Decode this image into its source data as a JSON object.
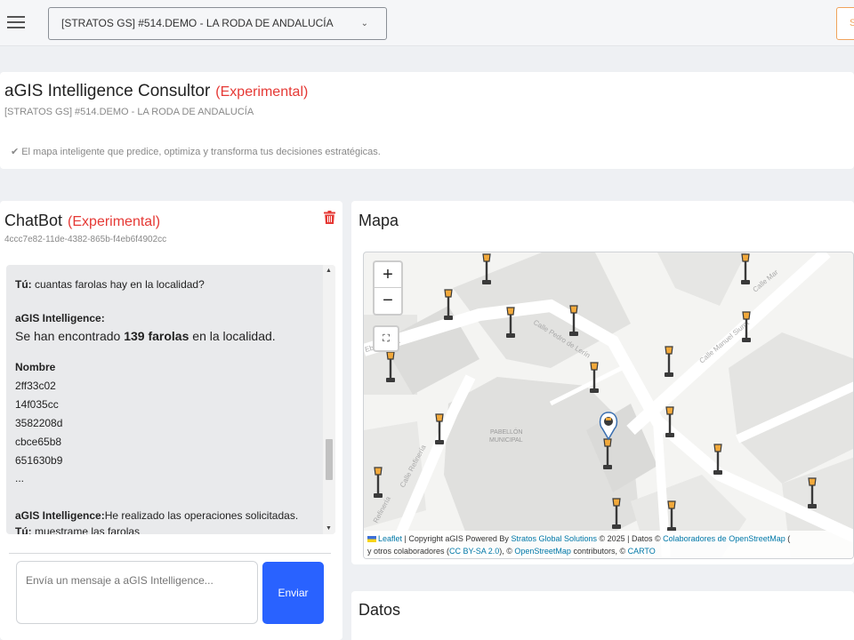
{
  "topbar": {
    "project_select": "[STRATOS GS] #514.DEMO - LA RODA DE ANDALUCÍA",
    "caret": "⌄",
    "right_button": "S"
  },
  "header": {
    "title": "aGIS Intelligence Consultor",
    "experimental": "(Experimental)",
    "subtitle": "[STRATOS GS] #514.DEMO - LA RODA DE ANDALUCÍA",
    "tagline": "El mapa inteligente que predice, optimiza y transforma tus decisiones estratégicas."
  },
  "chatbot": {
    "title": "ChatBot",
    "experimental": "(Experimental)",
    "session_id": "4ccc7e82-11de-4382-865b-f4eb6f4902cc",
    "messages": {
      "user1_label": "Tú:",
      "user1_text": " cuantas farolas hay en la localidad?",
      "bot_label": "aGIS Intelligence:",
      "bot_pre": "Se han encontrado ",
      "bot_bold": "139 farolas",
      "bot_post": " en la localidad.",
      "table_header": "Nombre",
      "rows": [
        "2ff33c02",
        "14f035cc",
        "3582208d",
        "cbce65b8",
        "651630b9",
        "..."
      ],
      "bot2_label": "aGIS Intelligence:",
      "bot2_text": "He realizado las operaciones solicitadas.",
      "user2_label": "Tú:",
      "user2_text": " muestrame las farolas"
    },
    "input_placeholder": "Envía un mensaje a aGIS Intelligence...",
    "send_label": "Enviar"
  },
  "map": {
    "title": "Mapa",
    "zoom_in": "+",
    "zoom_out": "−",
    "fullscreen": "⛶",
    "street_labels": [
      "Calle Pedro de Lerín",
      "Calle Manuel Siurot",
      "Calle Refinería",
      "Refinería",
      "Calle Mar",
      "Ebanistería"
    ],
    "building_label_1": "PABELLÓN",
    "building_label_2": "MUNICIPAL",
    "attribution": {
      "leaflet": "Leaflet",
      "part1": " | Copyright aGIS Powered By ",
      "stratos": "Stratos Global Solutions",
      "part2": " © 2025 | Datos © ",
      "osm_collab": "Colaboradores de OpenStreetMap",
      "part3": " (",
      "line2_pre": "y otros colaboradores (",
      "ccbysa": "CC BY-SA 2.0",
      "line2_mid": "), © ",
      "osm": "OpenStreetMap",
      "line2_post": " contributors, © ",
      "carto": "CARTO"
    }
  },
  "datos": {
    "title": "Datos"
  },
  "colors": {
    "accent": "#2962ff",
    "experimental": "#e53935",
    "link": "#0078a8",
    "lamp_body": "#3a3a3a",
    "lamp_light": "#f2a93b"
  }
}
